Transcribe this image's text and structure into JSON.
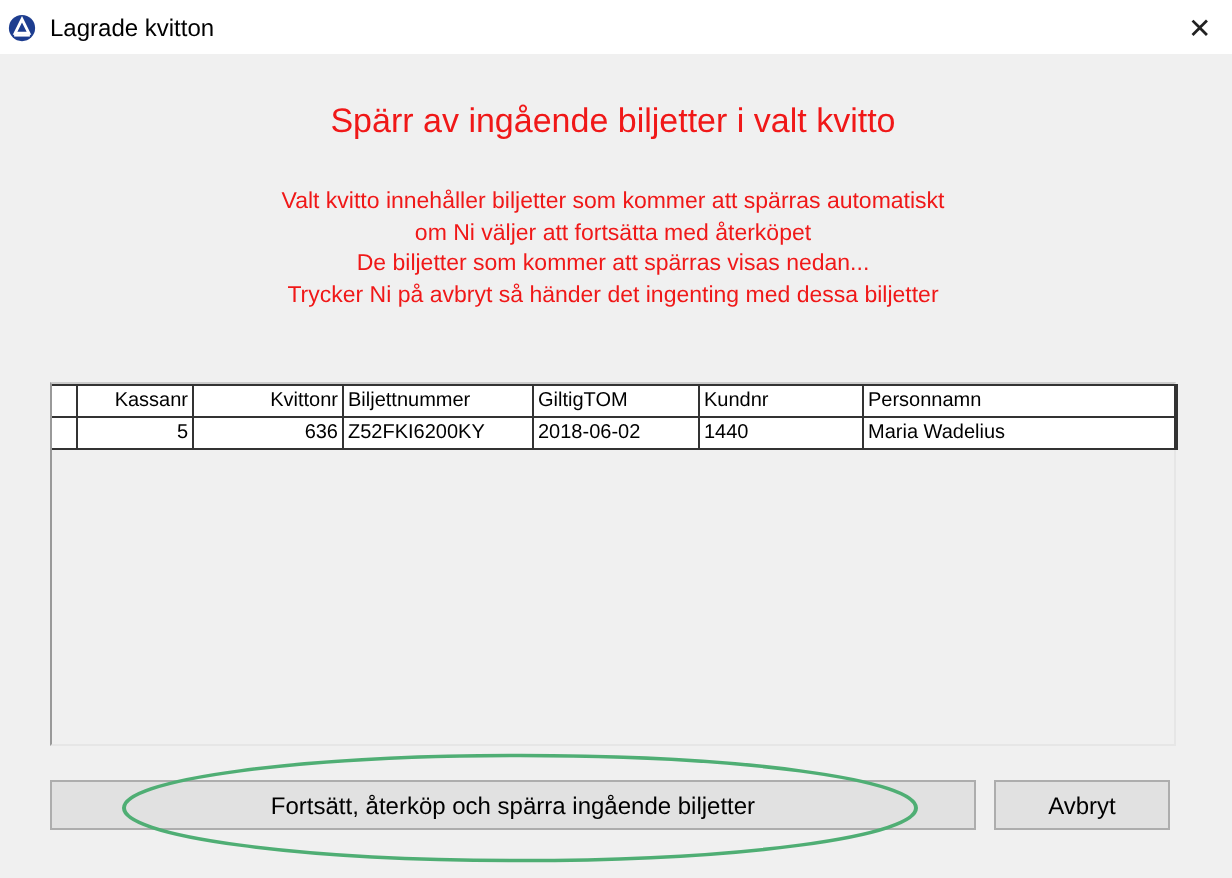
{
  "window": {
    "title": "Lagrade kvitton",
    "close": "✕"
  },
  "heading": "Spärr av ingående biljetter i valt kvitto",
  "message": [
    "Valt kvitto innehåller biljetter som kommer att spärras automatiskt",
    "om Ni väljer att fortsätta med återköpet",
    "De biljetter som kommer att spärras visas nedan...",
    "Trycker Ni på avbryt så händer det ingenting med dessa biljetter"
  ],
  "table": {
    "columns": [
      {
        "label": "Kassanr",
        "right_aligned": true
      },
      {
        "label": "Kvittonr",
        "right_aligned": true
      },
      {
        "label": "Biljettnummer",
        "right_aligned": false
      },
      {
        "label": "GiltigTOM",
        "right_aligned": false
      },
      {
        "label": "Kundnr",
        "right_aligned": false
      },
      {
        "label": "Personnamn",
        "right_aligned": false
      }
    ],
    "rows": [
      [
        "5",
        "636",
        "Z52FKI6200KY",
        "2018-06-02",
        "1440",
        "Maria Wadelius"
      ]
    ]
  },
  "buttons": [
    {
      "label": "Fortsätt, återköp och spärra ingående biljetter",
      "highlighted": true
    },
    {
      "label": "Avbryt",
      "highlighted": false
    }
  ]
}
